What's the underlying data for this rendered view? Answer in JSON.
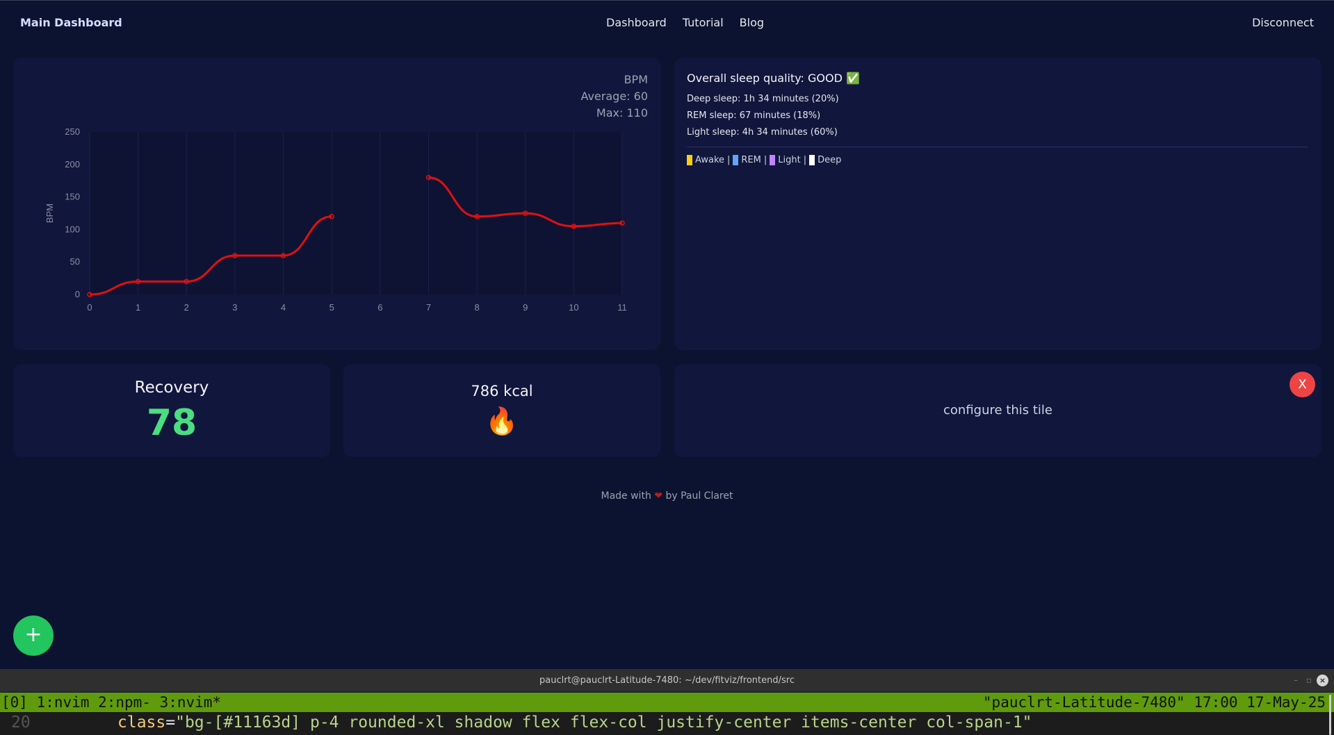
{
  "nav": {
    "brand": "Main Dashboard",
    "links": [
      "Dashboard",
      "Tutorial",
      "Blog"
    ],
    "disconnect": "Disconnect"
  },
  "bpm": {
    "label": "BPM",
    "average": "Average: 60",
    "max": "Max: 110"
  },
  "chart_data": {
    "type": "line",
    "x": [
      0,
      1,
      2,
      3,
      4,
      5,
      6,
      7,
      8,
      9,
      10,
      11
    ],
    "series": [
      {
        "values": [
          0,
          20,
          20,
          60,
          60,
          120,
          null,
          180,
          120,
          125,
          105,
          110
        ]
      }
    ],
    "ylabel": "BPM",
    "xlabel": "",
    "ylim": [
      0,
      250
    ],
    "yticks": [
      0,
      50,
      100,
      150,
      200,
      250
    ],
    "xticks": [
      "0",
      "1",
      "2",
      "3",
      "4",
      "5",
      "6",
      "7",
      "8",
      "9",
      "10",
      "11"
    ],
    "line_color": "#e11010",
    "grid": true
  },
  "sleep": {
    "title": "Overall sleep quality: GOOD ✅",
    "deep": "Deep sleep: 1h 34 minutes (20%)",
    "rem": "REM sleep: 67 minutes (18%)",
    "light": "Light sleep: 4h 34 minutes (60%)",
    "legend": [
      {
        "label": "Awake",
        "color": "#facc15"
      },
      {
        "label": "REM",
        "color": "#60a5fa"
      },
      {
        "label": "Light",
        "color": "#c084fc"
      },
      {
        "label": "Deep",
        "color": "#ffffff"
      }
    ],
    "legend_sep": "|"
  },
  "recovery": {
    "title": "Recovery",
    "value": "78"
  },
  "kcal": {
    "title": "786 kcal",
    "icon": "🔥"
  },
  "config": {
    "text": "configure this tile",
    "close": "X"
  },
  "footer": {
    "pre": "Made with",
    "heart": "❤",
    "post": "by Paul Claret"
  },
  "fab": {
    "label": "+"
  },
  "terminal": {
    "title": "pauclrt@pauclrt-Latitude-7480: ~/dev/fitviz/frontend/src",
    "tmux_left": "[0] 1:nvim  2:npm- 3:nvim*",
    "tmux_right": "\"pauclrt-Latitude-7480\" 17:00 17-May-25",
    "line_number": "20",
    "code_attr": "class",
    "code_eq": "=",
    "code_value": "\"bg-[#11163d] p-4 rounded-xl shadow flex flex-col justify-center items-center col-span-1\"",
    "minimize": "–",
    "maximize": "▫",
    "close": "×"
  }
}
